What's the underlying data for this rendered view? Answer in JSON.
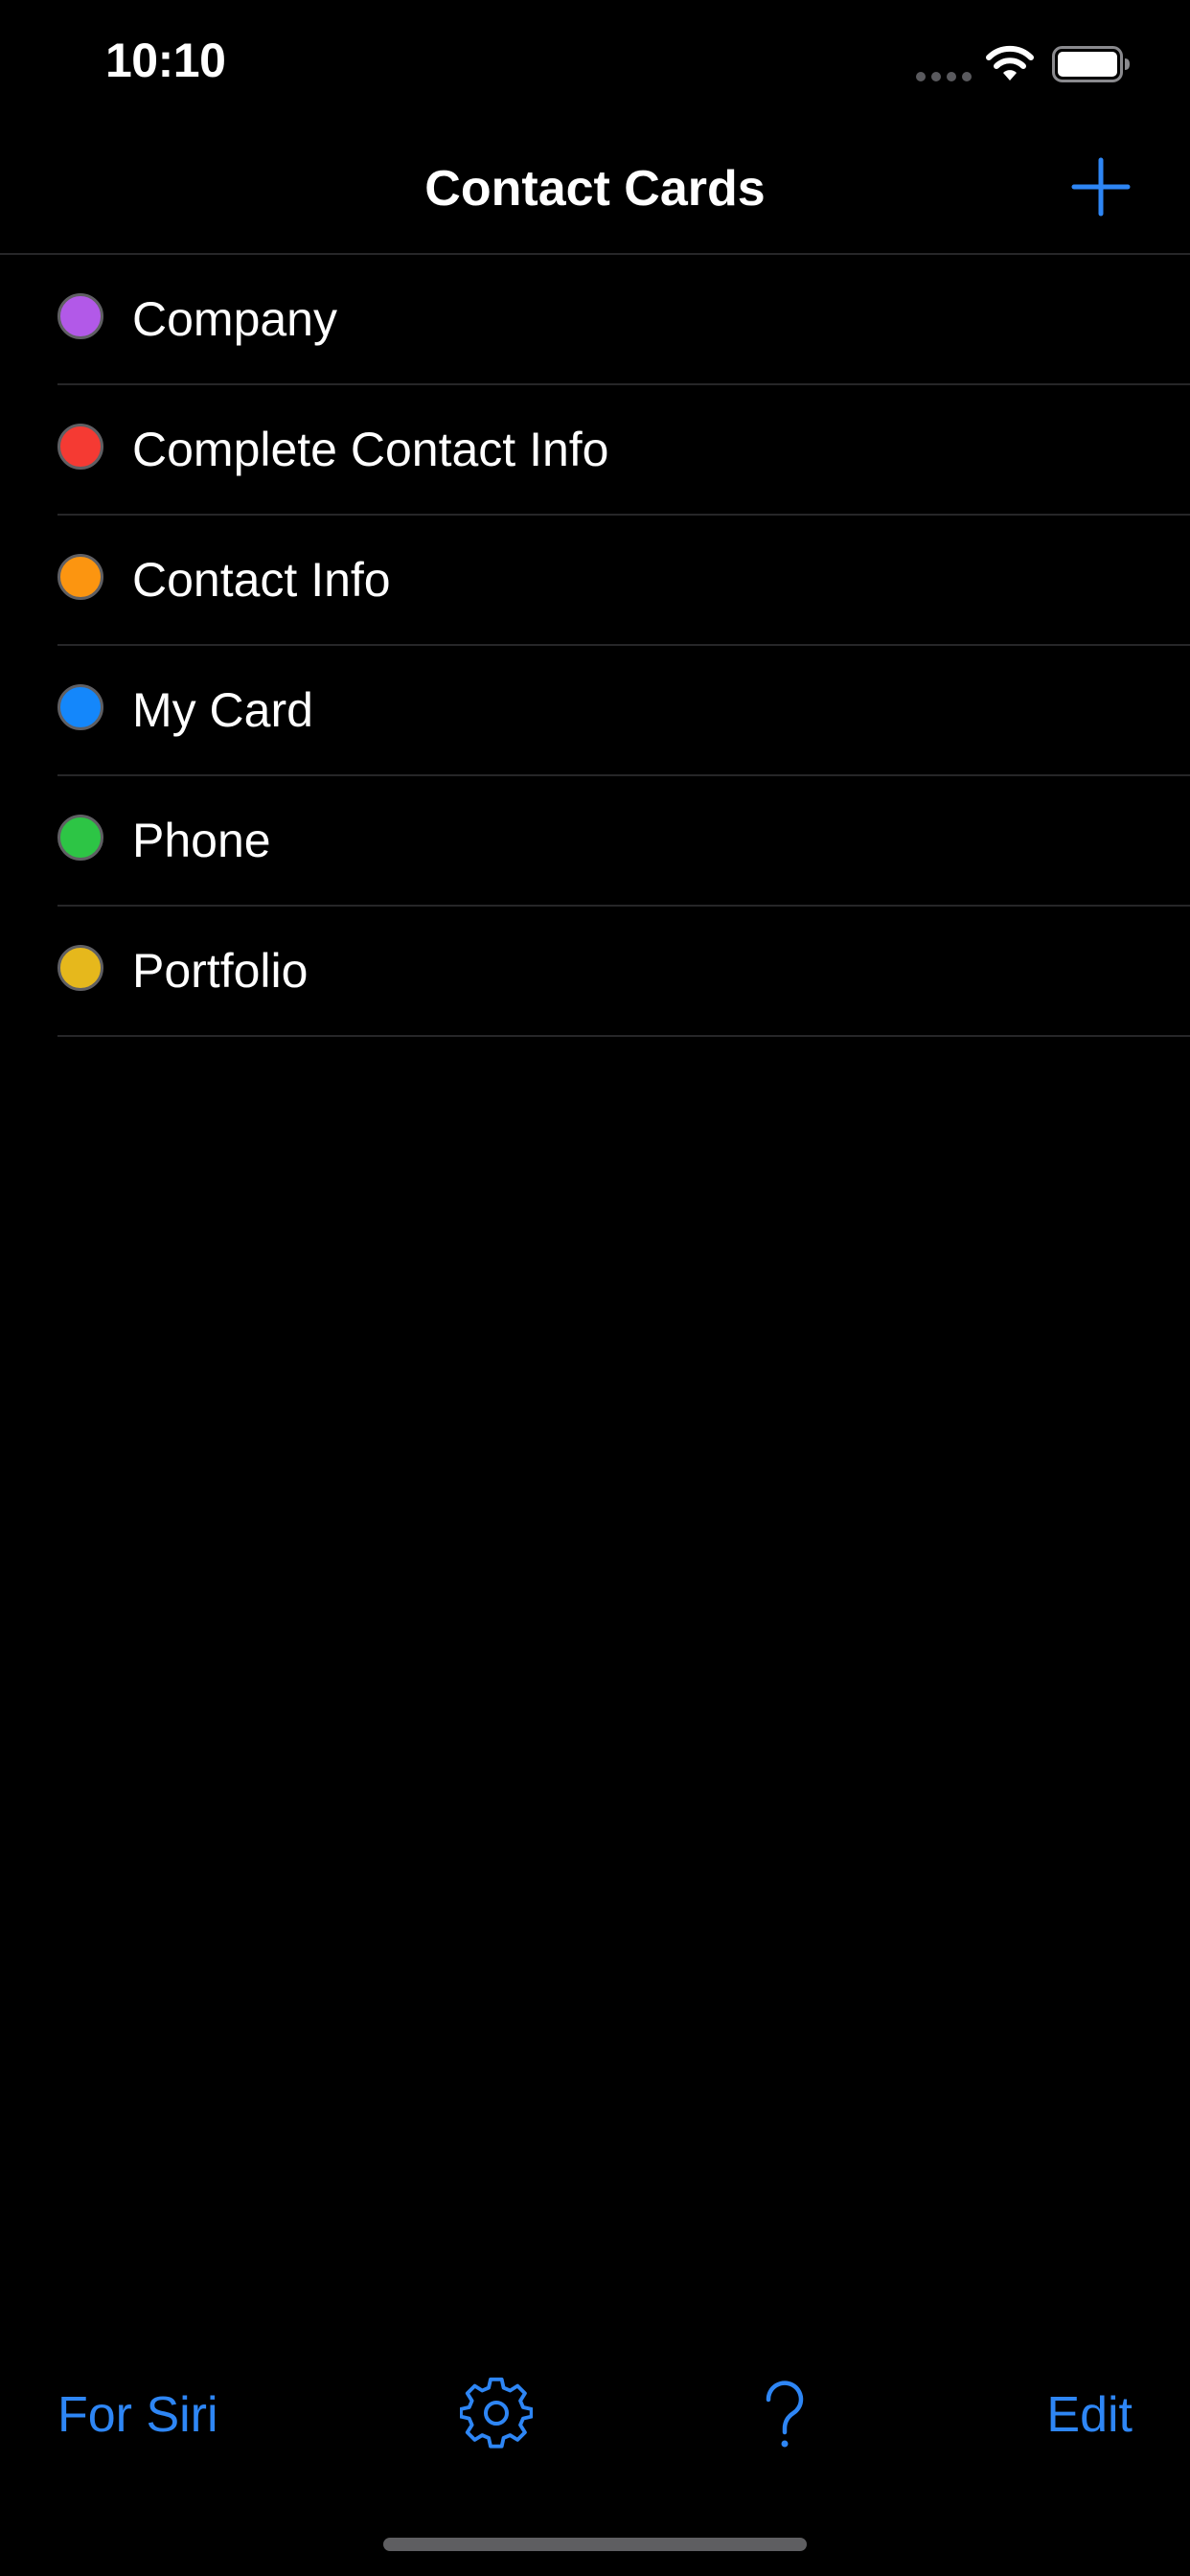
{
  "status_bar": {
    "time": "10:10",
    "icons": [
      "cellular-signal-icon",
      "wifi-icon",
      "battery-icon"
    ]
  },
  "nav": {
    "title": "Contact Cards",
    "add_icon": "plus-icon"
  },
  "cards": [
    {
      "label": "Company",
      "color": "#b259e8"
    },
    {
      "label": "Complete Contact Info",
      "color": "#f53a33"
    },
    {
      "label": "Contact Info",
      "color": "#fc9510"
    },
    {
      "label": "My Card",
      "color": "#1487fb"
    },
    {
      "label": "Phone",
      "color": "#2dc545"
    },
    {
      "label": "Portfolio",
      "color": "#e6b81c"
    }
  ],
  "toolbar": {
    "for_siri_label": "For Siri",
    "settings_icon": "gear-icon",
    "help_icon": "question-mark-icon",
    "edit_label": "Edit"
  },
  "colors": {
    "background": "#000000",
    "accent": "#2e86f5",
    "separator": "#262628",
    "text": "#ffffff"
  }
}
